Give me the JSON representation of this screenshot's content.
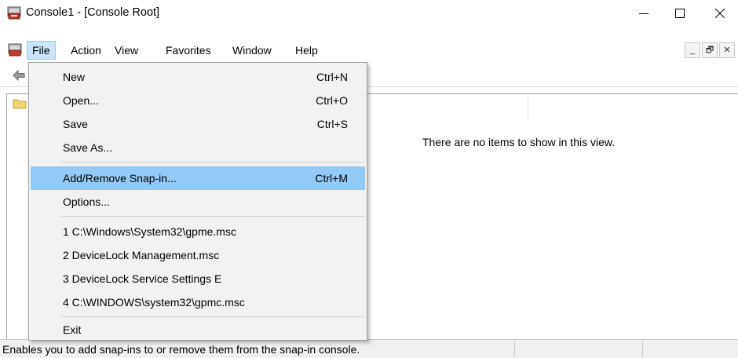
{
  "window": {
    "title": "Console1 - [Console Root]",
    "icon": "mmc-console-icon",
    "controls": {
      "minimize": "—",
      "maximize": "☐",
      "close": "✕"
    }
  },
  "menubar": {
    "items": [
      {
        "label": "File",
        "active": true
      },
      {
        "label": "Action"
      },
      {
        "label": "View"
      },
      {
        "label": "Favorites"
      },
      {
        "label": "Window"
      },
      {
        "label": "Help"
      }
    ],
    "mdi_controls": {
      "minimize": "_",
      "restore": "🗗",
      "close": "✕"
    }
  },
  "file_menu": {
    "items": [
      {
        "label": "New",
        "shortcut": "Ctrl+N"
      },
      {
        "label": "Open...",
        "shortcut": "Ctrl+O"
      },
      {
        "label": "Save",
        "shortcut": "Ctrl+S"
      },
      {
        "label": "Save As...",
        "shortcut": ""
      },
      {
        "label": "Add/Remove Snap-in...",
        "shortcut": "Ctrl+M",
        "highlighted": true
      },
      {
        "label": "Options...",
        "shortcut": ""
      },
      {
        "label": "1 C:\\Windows\\System32\\gpme.msc",
        "shortcut": ""
      },
      {
        "label": "2 DeviceLock Management.msc",
        "shortcut": ""
      },
      {
        "label": "3 DeviceLock Service Settings E",
        "shortcut": ""
      },
      {
        "label": "4 C:\\WINDOWS\\system32\\gpmc.msc",
        "shortcut": ""
      },
      {
        "label": "Exit",
        "shortcut": ""
      }
    ]
  },
  "content": {
    "empty_message": "There are no items to show in this view."
  },
  "statusbar": {
    "text": "Enables you to add snap-ins to or remove them from the snap-in console."
  },
  "colors": {
    "highlight": "#91c9f7",
    "menu_active": "#cce4f7",
    "menu_bg": "#f2f2f2"
  }
}
